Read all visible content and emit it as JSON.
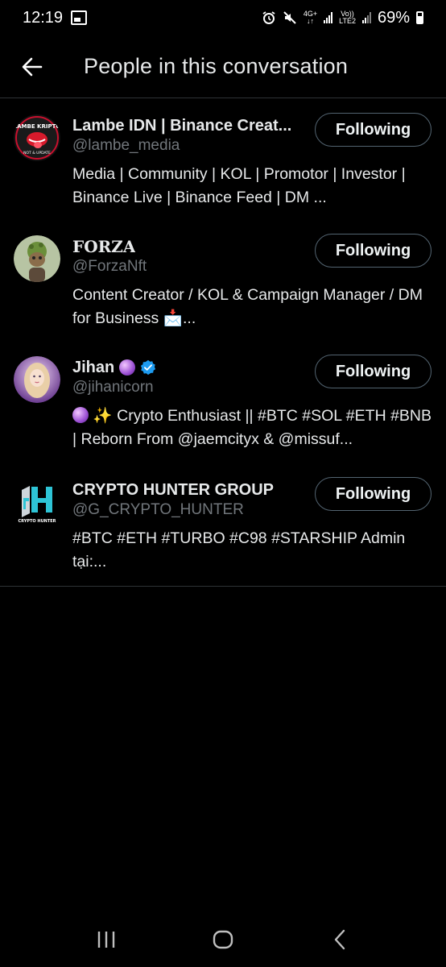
{
  "status_bar": {
    "time": "12:19",
    "network_top": "4G+",
    "network_mid": "Vo))",
    "network_bottom": "LTE2",
    "battery_percent": "69%"
  },
  "header": {
    "title": "People in this conversation",
    "back_icon": "arrow-left-icon"
  },
  "people": [
    {
      "name": "Lambe IDN | Binance Creat...",
      "handle": "@lambe_media",
      "bio": "Media | Community | KOL | Promotor | Investor | Binance Live | Binance Feed | DM ...",
      "button": "Following",
      "verified": false
    },
    {
      "name": "FORZA",
      "handle": "@ForzaNft",
      "bio": "Content Creator / KOL & Campaign Manager / DM for Business 📩...",
      "button": "Following",
      "verified": false
    },
    {
      "name": "Jihan",
      "handle": "@jihanicorn",
      "bio": "✨ Crypto Enthusiast || #BTC #SOL #ETH #BNB | Reborn From @jaemcityx & @missuf...",
      "button": "Following",
      "verified": true
    },
    {
      "name": "CRYPTO HUNTER GROUP",
      "handle": "@G_CRYPTO_HUNTER",
      "bio": "#BTC #ETH #TURBO #C98 #STARSHIP Admin tại:...",
      "button": "Following",
      "verified": false
    }
  ],
  "avatar_texts": {
    "lambe_top": "LAMBE KRIPTO",
    "lambe_bottom": "NOT & UPDATE",
    "hunter": "CRYPTO HUNTER"
  },
  "colors": {
    "background": "#000000",
    "text_primary": "#e7e9ea",
    "text_secondary": "#71767b",
    "divider": "#2f3336",
    "verified_blue": "#1d9bf0"
  }
}
